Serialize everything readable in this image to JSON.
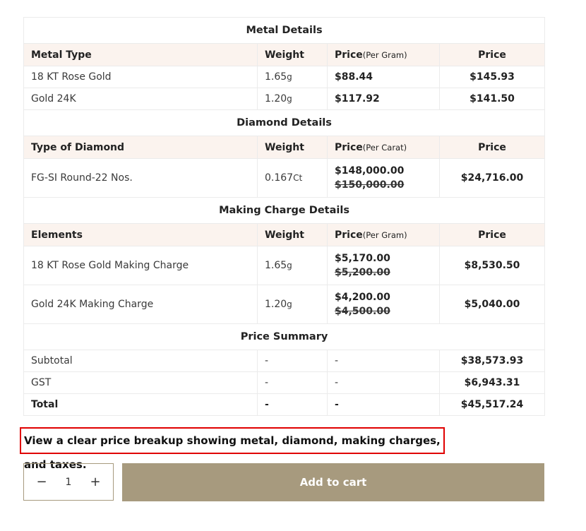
{
  "metal": {
    "title": "Metal Details",
    "headers": {
      "c1": "Metal Type",
      "c2": "Weight",
      "c3": "Price",
      "c3_unit": "(Per Gram)",
      "c4": "Price"
    },
    "rows": [
      {
        "name": "18 KT Rose Gold",
        "weight": "1.65",
        "unit": "g",
        "rate": "$88.44",
        "price": "$145.93"
      },
      {
        "name": "Gold 24K",
        "weight": "1.20",
        "unit": "g",
        "rate": "$117.92",
        "price": "$141.50"
      }
    ]
  },
  "diamond": {
    "title": "Diamond Details",
    "headers": {
      "c1": "Type of Diamond",
      "c2": "Weight",
      "c3": "Price",
      "c3_unit": "(Per Carat)",
      "c4": "Price"
    },
    "rows": [
      {
        "name": "FG-SI Round-22 Nos.",
        "weight": "0.167",
        "unit": "Ct",
        "rate": "$148,000.00",
        "rate_old": "$150,000.00",
        "price": "$24,716.00"
      }
    ]
  },
  "making": {
    "title": "Making Charge Details",
    "headers": {
      "c1": "Elements",
      "c2": "Weight",
      "c3": "Price",
      "c3_unit": "(Per Gram)",
      "c4": "Price"
    },
    "rows": [
      {
        "name": "18 KT Rose Gold Making Charge",
        "weight": "1.65",
        "unit": "g",
        "rate": "$5,170.00",
        "rate_old": "$5,200.00",
        "price": "$8,530.50"
      },
      {
        "name": "Gold 24K Making Charge",
        "weight": "1.20",
        "unit": "g",
        "rate": "$4,200.00",
        "rate_old": "$4,500.00",
        "price": "$5,040.00"
      }
    ]
  },
  "summary": {
    "title": "Price Summary",
    "rows": [
      {
        "name": "Subtotal",
        "c2": "-",
        "c3": "-",
        "price": "$38,573.93"
      },
      {
        "name": "GST",
        "c2": "-",
        "c3": "-",
        "price": "$6,943.31"
      },
      {
        "name": "Total",
        "c2": "-",
        "c3": "-",
        "price": "$45,517.24"
      }
    ]
  },
  "caption": "View a clear price breakup showing metal, diamond, making charges, and taxes.",
  "quantity": {
    "minus": "−",
    "value": "1",
    "plus": "+"
  },
  "add_to_cart": "Add to cart",
  "colors": {
    "header_bg": "#fbf3ee",
    "button_bg": "#a79a7e",
    "caption_border": "#e00000"
  }
}
